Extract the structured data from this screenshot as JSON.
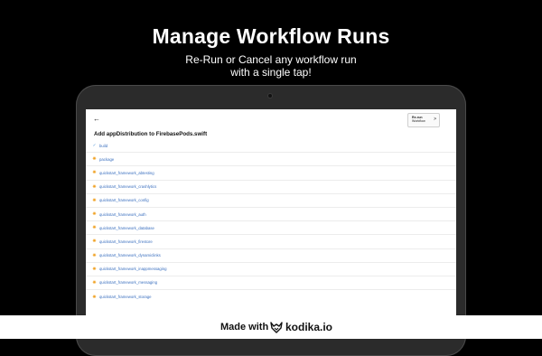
{
  "promo": {
    "headline": "Manage Workflow Runs",
    "subline_1": "Re-Run or Cancel any workflow run",
    "subline_2": "with a single tap!"
  },
  "app": {
    "back_icon": "arrow-left-icon",
    "rerun_line1": "Re-run",
    "rerun_line2": "Workflow",
    "rerun_icon": "chevron-right-icon",
    "title": "Add appDistribution to FirebasePods.swift",
    "jobs": [
      {
        "name": "build",
        "status": "success",
        "icon": "check-icon"
      },
      {
        "name": "package",
        "status": "in-progress",
        "icon": "spinner-icon"
      },
      {
        "name": "quickstart_framework_abtesting",
        "status": "in-progress",
        "icon": "spinner-icon"
      },
      {
        "name": "quickstart_framework_crashlytics",
        "status": "in-progress",
        "icon": "spinner-icon"
      },
      {
        "name": "quickstart_framework_config",
        "status": "in-progress",
        "icon": "spinner-icon"
      },
      {
        "name": "quickstart_framework_auth",
        "status": "in-progress",
        "icon": "spinner-icon"
      },
      {
        "name": "quickstart_framework_database",
        "status": "in-progress",
        "icon": "spinner-icon"
      },
      {
        "name": "quickstart_framework_firestore",
        "status": "in-progress",
        "icon": "spinner-icon"
      },
      {
        "name": "quickstart_framework_dynamiclinks",
        "status": "in-progress",
        "icon": "spinner-icon"
      },
      {
        "name": "quickstart_framework_inappmessaging",
        "status": "in-progress",
        "icon": "spinner-icon"
      },
      {
        "name": "quickstart_framework_messaging",
        "status": "in-progress",
        "icon": "spinner-icon"
      },
      {
        "name": "quickstart_framework_storage",
        "status": "in-progress",
        "icon": "spinner-icon"
      }
    ]
  },
  "footer": {
    "made_with": "Made with",
    "brand": "kodika.io",
    "logo_icon": "fox-logo-icon"
  },
  "colors": {
    "in_progress": "#f0a020",
    "success": "#4a90d9",
    "link": "#3a6fbf"
  }
}
